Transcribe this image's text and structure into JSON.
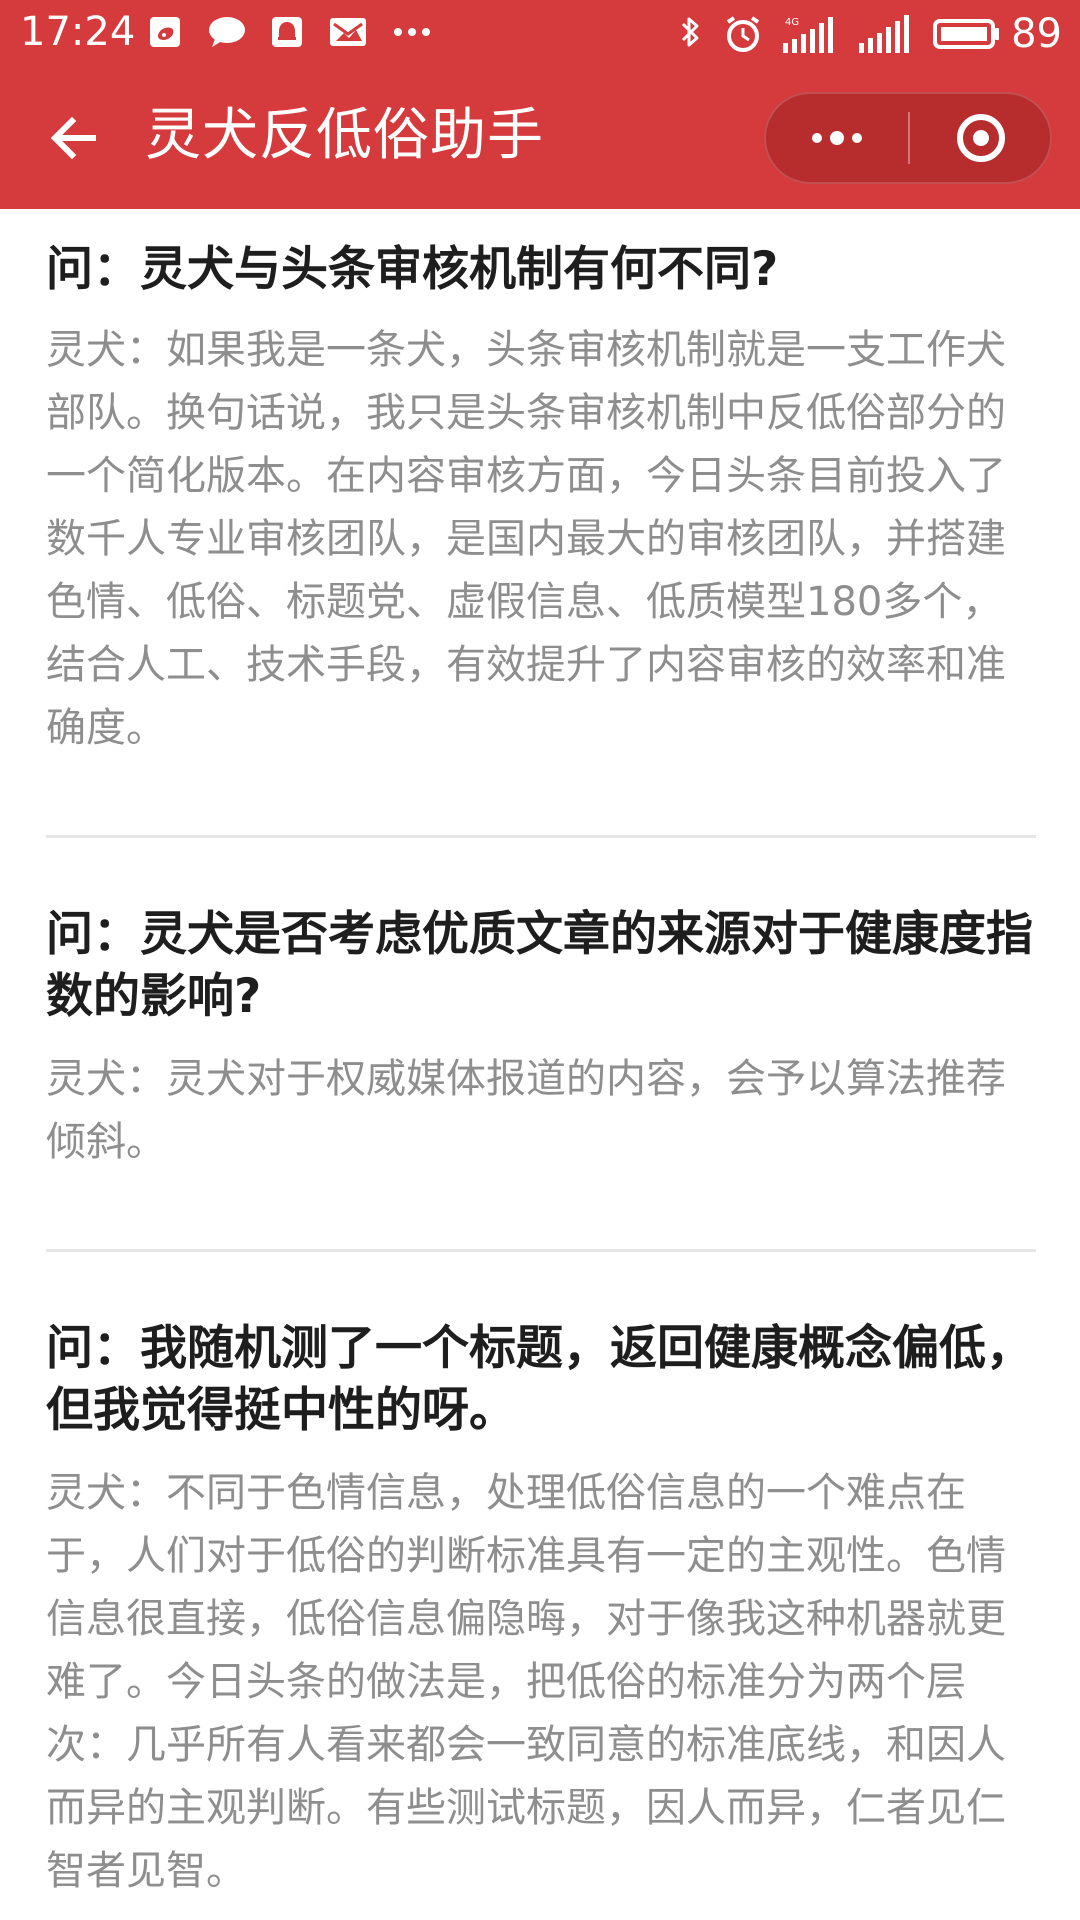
{
  "status_bar": {
    "time": "17:24",
    "battery_level": "89",
    "network_type": "4G"
  },
  "header": {
    "title": "灵犬反低俗助手"
  },
  "faq_items": [
    {
      "question": "问：灵犬与头条审核机制有何不同?",
      "answer": "灵犬：如果我是一条犬，头条审核机制就是一支工作犬部队。换句话说，我只是头条审核机制中反低俗部分的一个简化版本。在内容审核方面，今日头条目前投入了数千人专业审核团队，是国内最大的审核团队，并搭建色情、低俗、标题党、虚假信息、低质模型180多个，结合人工、技术手段，有效提升了内容审核的效率和准确度。"
    },
    {
      "question": "问：灵犬是否考虑优质文章的来源对于健康度指数的影响?",
      "answer": "灵犬：灵犬对于权威媒体报道的内容，会予以算法推荐倾斜。"
    },
    {
      "question": "问：我随机测了一个标题，返回健康概念偏低，但我觉得挺中性的呀。",
      "answer": "灵犬：不同于色情信息，处理低俗信息的一个难点在于，人们对于低俗的判断标准具有一定的主观性。色情信息很直接，低俗信息偏隐晦，对于像我这种机器就更难了。今日头条的做法是，把低俗的标准分为两个层次：几乎所有人看来都会一致同意的标准底线，和因人而异的主观判断。有些测试标题，因人而异，仁者见仁智者见智。"
    }
  ],
  "colors": {
    "top_bar": "#d53a3c",
    "question_text": "#1e1e1e",
    "answer_text": "#8e8e8e",
    "separator": "#e6e6e6",
    "background": "#ffffff"
  },
  "icons": {
    "back": "arrow-left-icon",
    "menu": "more-dots-icon",
    "close": "target-close-icon",
    "bluetooth": "bluetooth-icon",
    "alarm": "alarm-icon",
    "signal": "signal-icon",
    "battery": "battery-icon",
    "weibo": "weibo-icon",
    "message": "message-icon",
    "notification": "bell-icon",
    "mail": "mail-icon",
    "more_notifications": "ellipsis-icon"
  }
}
